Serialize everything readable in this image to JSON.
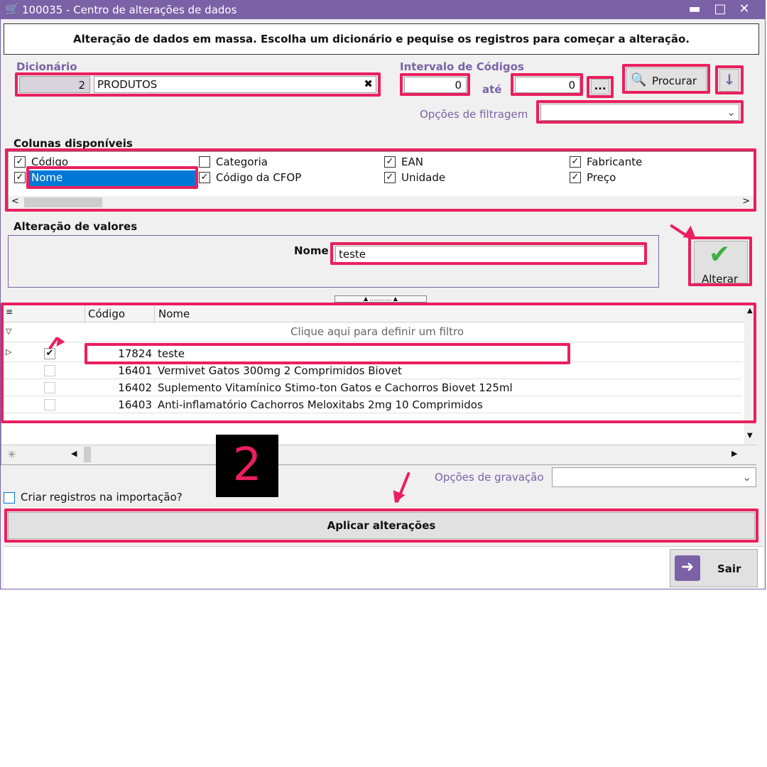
{
  "window": {
    "title": "100035 - Centro de alterações de dados",
    "banner": "Alteração de dados em massa. Escolha um dicionário e pequise os registros para começar a alteração."
  },
  "dictionary": {
    "label": "Dicionário",
    "code": "2",
    "name": "PRODUTOS"
  },
  "range": {
    "label": "Intervalo de Códigos",
    "from": "0",
    "to_label": "até",
    "to": "0",
    "ellipsis": "...",
    "search_label": "Procurar"
  },
  "filter": {
    "label": "Opções de filtragem",
    "value": ""
  },
  "columns": {
    "title": "Colunas disponíveis",
    "items": [
      {
        "label": "Código",
        "checked": true
      },
      {
        "label": "Nome",
        "checked": true
      },
      {
        "label": "Categoria",
        "checked": false
      },
      {
        "label": "Código da CFOP",
        "checked": true
      },
      {
        "label": "EAN",
        "checked": true
      },
      {
        "label": "Unidade",
        "checked": true
      },
      {
        "label": "Fabricante",
        "checked": true
      },
      {
        "label": "Preço",
        "checked": true
      }
    ]
  },
  "values": {
    "title": "Alteração de valores",
    "field_label": "Nome",
    "field_value": "teste",
    "apply_label": "Alterar"
  },
  "grid": {
    "headers": [
      "Código",
      "Nome"
    ],
    "filter_hint": "Clique aqui para definir um filtro",
    "rows": [
      {
        "code": "17824",
        "name": "teste",
        "checked": true
      },
      {
        "code": "16401",
        "name": "Vermivet Gatos 300mg 2 Comprimidos Biovet",
        "checked": false
      },
      {
        "code": "16402",
        "name": "Suplemento Vitamínico Stimo-ton Gatos e Cachorros Biovet 125ml",
        "checked": false
      },
      {
        "code": "16403",
        "name": "Anti-inflamatório Cachorros Meloxitabs 2mg 10 Comprimidos",
        "checked": false
      }
    ]
  },
  "save": {
    "label": "Opções de gravação",
    "value": ""
  },
  "import": {
    "label": "Criar registros na importação?"
  },
  "apply_button": "Aplicar alterações",
  "exit_button": "Sair",
  "step_number": "2",
  "colors": {
    "accent": "#ea1f5e",
    "brand": "#7b62a6"
  }
}
